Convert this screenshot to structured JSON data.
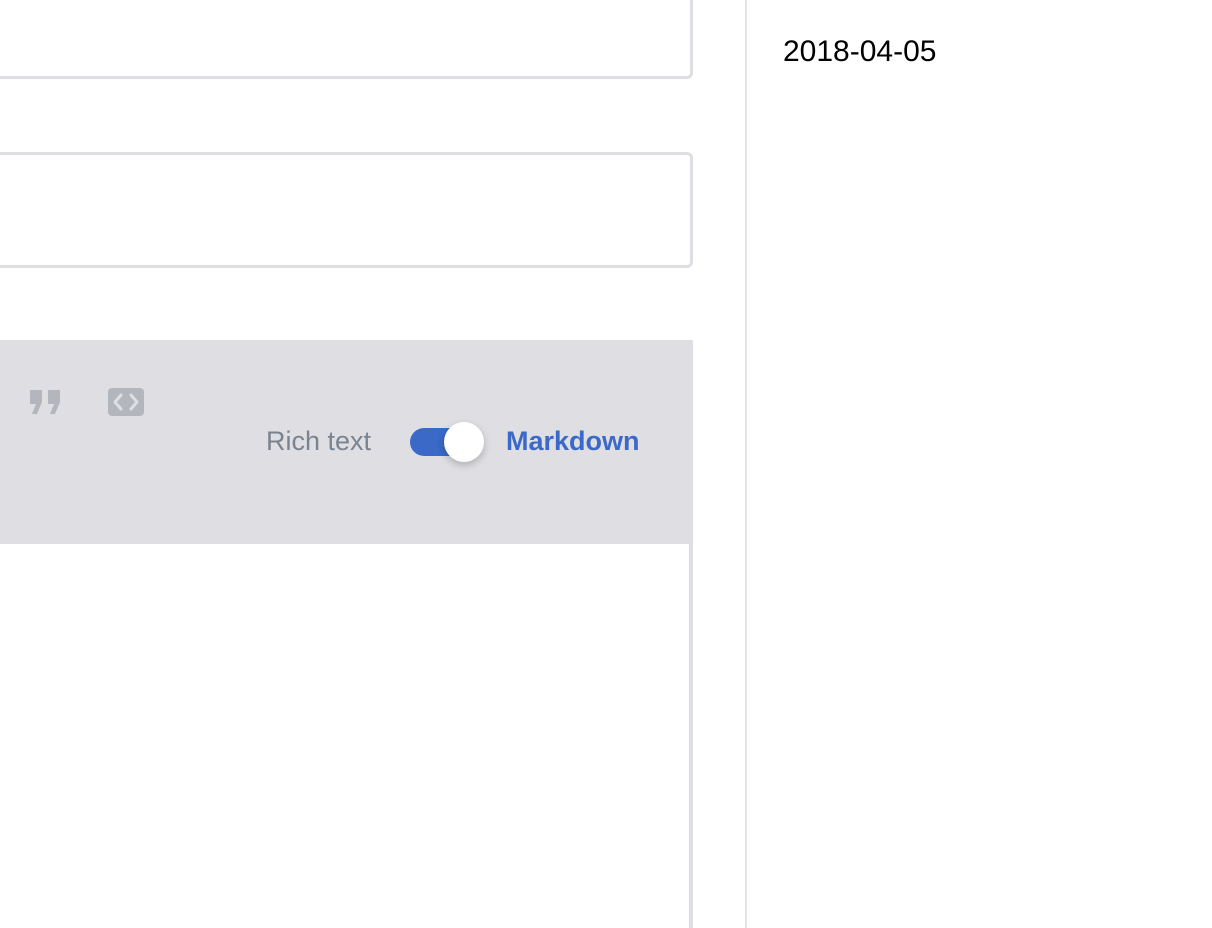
{
  "editor": {
    "toolbar": {
      "icons": [
        "quote-icon",
        "code-icon"
      ],
      "mode_toggle": {
        "rich_text_label": "Rich text",
        "markdown_label": "Markdown",
        "selected": "Markdown"
      }
    }
  },
  "sidebar": {
    "date": "2018-04-05"
  },
  "colors": {
    "accent": "#3a69c7",
    "toolbar_bg": "#dfdfe3",
    "muted_text": "#7a8390",
    "border": "#dfdfe3"
  }
}
